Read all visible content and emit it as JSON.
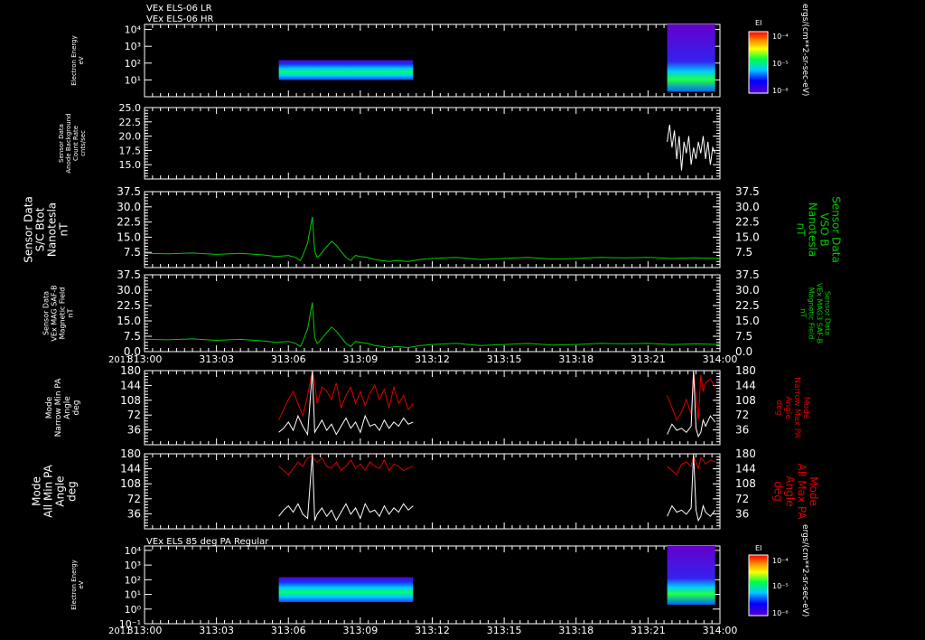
{
  "titles": {
    "top_line1": "VEx ELS-06 LR",
    "top_line2": "VEx ELS-06 HR",
    "bottom": "VEx ELS 85 deg PA Regular"
  },
  "colorbar": {
    "label": "EI",
    "ticks": [
      "10⁻⁴",
      "10⁻⁵",
      "10⁻⁶"
    ],
    "units": "ergs/(cm**2-sr-sec-eV)"
  },
  "time_axis": {
    "year": "2011",
    "ticks": [
      "313:00",
      "313:03",
      "313:06",
      "313:09",
      "313:12",
      "313:15",
      "313:18",
      "313:21",
      "314:00"
    ]
  },
  "colors": {
    "green": "#00cc00",
    "red": "#dd0000",
    "white": "#ffffff"
  },
  "chart_data": [
    {
      "type": "heatmap",
      "panel": "p1",
      "ylabel_lines": [
        "Electron Energy",
        "eV"
      ],
      "yticks": [
        "10⁴",
        "10³",
        "10²",
        "10¹"
      ],
      "ytick_values": [
        10000,
        1000,
        100,
        10
      ],
      "ylim": [
        1,
        20000
      ],
      "blocks": [
        {
          "x": [
            5.6,
            11.2
          ],
          "ylim": [
            10,
            150
          ]
        },
        {
          "x": [
            21.8,
            23.8
          ],
          "ylim": [
            2,
            20000
          ]
        }
      ]
    },
    {
      "type": "line",
      "panel": "p2",
      "ylabel_lines": [
        "Sensor Data",
        "Anode Background",
        "Count Rate",
        "cnts/sec"
      ],
      "yticks": [
        "25.0",
        "22.5",
        "20.0",
        "17.5",
        "15.0"
      ],
      "ytick_values": [
        25,
        22.5,
        20,
        17.5,
        15
      ],
      "ylim": [
        12.5,
        25
      ],
      "series": [
        {
          "color": "white",
          "x": [
            21.8,
            21.9,
            22.0,
            22.1,
            22.2,
            22.3,
            22.4,
            22.5,
            22.6,
            22.7,
            22.8,
            22.9,
            23.0,
            23.1,
            23.2,
            23.3,
            23.4,
            23.5,
            23.6,
            23.7,
            23.8
          ],
          "y": [
            19,
            22,
            18,
            21,
            16,
            20,
            14,
            19,
            17,
            20,
            15,
            18,
            16,
            19,
            17,
            20,
            16,
            19,
            15,
            18,
            17
          ]
        }
      ]
    },
    {
      "type": "line",
      "panel": "p3",
      "ylabel_lines": [
        "Sensor Data",
        "S/C Btot",
        "Nanotesla",
        "nT"
      ],
      "right_label_lines": [
        "Sensor Data",
        "VSO B",
        "Nanotesla",
        "nT"
      ],
      "yticks": [
        "37.5",
        "30.0",
        "22.5",
        "15.0",
        "7.5"
      ],
      "ytick_values": [
        37.5,
        30,
        22.5,
        15,
        7.5
      ],
      "ylim": [
        0,
        37.5
      ],
      "series": [
        {
          "color": "green",
          "x": [
            0,
            1,
            2,
            3,
            4,
            5,
            5.5,
            6,
            6.3,
            6.5,
            6.6,
            6.8,
            7.0,
            7.1,
            7.2,
            7.3,
            7.5,
            7.8,
            8.0,
            8.2,
            8.4,
            8.6,
            8.8,
            9.0,
            9.3,
            9.6,
            9.9,
            10.2,
            10.5,
            11.0,
            11.5,
            12,
            13,
            14,
            15,
            16,
            17,
            18,
            19,
            20,
            21,
            22,
            23,
            24
          ],
          "y": [
            7,
            6.8,
            7.2,
            6.5,
            7,
            6.2,
            5.5,
            6,
            5,
            3.5,
            6,
            12,
            25,
            8,
            5,
            6,
            9,
            13,
            11,
            8,
            5,
            3.5,
            6,
            5.5,
            5,
            4,
            3.5,
            3,
            3.5,
            3,
            4,
            4.5,
            5,
            4,
            4.5,
            5,
            4.2,
            4.5,
            5,
            4.8,
            5,
            4.5,
            4.8,
            4.5
          ]
        }
      ]
    },
    {
      "type": "line",
      "panel": "p4",
      "ylabel_lines": [
        "Sensor Data",
        "VEx MAG SAF-B",
        "Magnetic Field",
        "nT"
      ],
      "right_label_lines": [
        "Sensor Data",
        "VEx MAG3 SAF-B",
        "Magnetic Field",
        "nT"
      ],
      "yticks": [
        "37.5",
        "30.0",
        "22.5",
        "15.0",
        "7.5",
        "0.0"
      ],
      "ytick_values": [
        37.5,
        30,
        22.5,
        15,
        7.5,
        0
      ],
      "ylim": [
        0,
        37.5
      ],
      "series": [
        {
          "color": "green",
          "x": [
            0,
            1,
            2,
            3,
            4,
            5,
            5.5,
            6,
            6.3,
            6.5,
            6.6,
            6.8,
            7.0,
            7.1,
            7.2,
            7.3,
            7.5,
            7.8,
            8.0,
            8.2,
            8.4,
            8.6,
            8.8,
            9.0,
            9.3,
            9.6,
            9.9,
            10.2,
            10.5,
            11.0,
            11.5,
            12,
            13,
            14,
            15,
            16,
            17,
            18,
            19,
            20,
            21,
            22,
            23,
            24
          ],
          "y": [
            6,
            5.8,
            6.2,
            5.5,
            6,
            5.2,
            4.5,
            5,
            4,
            2.5,
            5,
            11,
            24,
            7,
            4,
            5,
            8,
            12,
            10,
            7,
            4,
            2.5,
            5,
            4.5,
            4,
            3,
            2.5,
            2,
            2.5,
            2,
            3,
            3.5,
            4,
            3,
            3.5,
            4,
            3.2,
            3.5,
            4,
            3.8,
            4,
            3.5,
            3.8,
            3.5
          ]
        }
      ]
    },
    {
      "type": "line",
      "panel": "p5",
      "ylabel_lines": [
        "Mode",
        "Narrow Min PA",
        "Angle",
        "deg"
      ],
      "right_label_lines": [
        "Mode",
        "Narrow Max PA",
        "Angle",
        "deg"
      ],
      "yticks": [
        "180",
        "144",
        "108",
        "72",
        "36"
      ],
      "ytick_values": [
        180,
        144,
        108,
        72,
        36
      ],
      "ylim": [
        0,
        180
      ],
      "series": [
        {
          "color": "red",
          "x": [
            5.6,
            5.8,
            6.0,
            6.2,
            6.4,
            6.6,
            6.8,
            7.0,
            7.1,
            7.2,
            7.4,
            7.6,
            7.8,
            8.0,
            8.2,
            8.4,
            8.6,
            8.8,
            9.0,
            9.2,
            9.4,
            9.6,
            9.8,
            10.0,
            10.2,
            10.4,
            10.6,
            10.8,
            11.0,
            11.2
          ],
          "y": [
            60,
            85,
            110,
            130,
            100,
            70,
            120,
            180,
            150,
            100,
            140,
            130,
            110,
            150,
            90,
            120,
            140,
            100,
            130,
            95,
            125,
            145,
            110,
            135,
            90,
            140,
            100,
            120,
            85,
            100
          ]
        },
        {
          "color": "white",
          "x": [
            5.6,
            5.8,
            6.0,
            6.2,
            6.4,
            6.6,
            6.8,
            7.0,
            7.1,
            7.2,
            7.4,
            7.6,
            7.8,
            8.0,
            8.2,
            8.4,
            8.6,
            8.8,
            9.0,
            9.2,
            9.4,
            9.6,
            9.8,
            10.0,
            10.2,
            10.4,
            10.6,
            10.8,
            11.0,
            11.2
          ],
          "y": [
            30,
            40,
            55,
            35,
            70,
            45,
            25,
            180,
            30,
            40,
            60,
            35,
            50,
            25,
            45,
            65,
            40,
            55,
            30,
            70,
            45,
            50,
            35,
            60,
            40,
            55,
            45,
            65,
            50,
            55
          ]
        },
        {
          "color": "red",
          "x": [
            21.8,
            22.0,
            22.2,
            22.4,
            22.6,
            22.8,
            22.9,
            23.0,
            23.1,
            23.2,
            23.3,
            23.4,
            23.6,
            23.8
          ],
          "y": [
            120,
            90,
            60,
            80,
            110,
            75,
            180,
            120,
            60,
            170,
            130,
            150,
            160,
            140
          ]
        },
        {
          "color": "white",
          "x": [
            21.8,
            22.0,
            22.2,
            22.4,
            22.6,
            22.8,
            22.9,
            23.0,
            23.1,
            23.2,
            23.3,
            23.4,
            23.6,
            23.8
          ],
          "y": [
            25,
            50,
            35,
            40,
            30,
            45,
            180,
            40,
            20,
            30,
            60,
            45,
            70,
            55
          ]
        }
      ]
    },
    {
      "type": "line",
      "panel": "p6",
      "ylabel_lines": [
        "Mode",
        "All Min PA",
        "Angle",
        "deg"
      ],
      "right_label_lines": [
        "Mode",
        "All Max PA",
        "Angle",
        "deg"
      ],
      "yticks": [
        "180",
        "144",
        "108",
        "72",
        "36"
      ],
      "ytick_values": [
        180,
        144,
        108,
        72,
        36
      ],
      "ylim": [
        0,
        180
      ],
      "series": [
        {
          "color": "red",
          "x": [
            5.6,
            5.8,
            6.0,
            6.2,
            6.4,
            6.6,
            6.8,
            7.0,
            7.1,
            7.2,
            7.4,
            7.6,
            7.8,
            8.0,
            8.2,
            8.4,
            8.6,
            8.8,
            9.0,
            9.2,
            9.4,
            9.6,
            9.8,
            10.0,
            10.2,
            10.4,
            10.6,
            10.8,
            11.0,
            11.2
          ],
          "y": [
            150,
            140,
            130,
            145,
            160,
            150,
            170,
            175,
            165,
            160,
            170,
            150,
            145,
            160,
            140,
            150,
            165,
            145,
            155,
            140,
            160,
            150,
            145,
            165,
            140,
            155,
            150,
            140,
            145,
            150
          ]
        },
        {
          "color": "white",
          "x": [
            5.6,
            5.8,
            6.0,
            6.2,
            6.4,
            6.6,
            6.8,
            7.0,
            7.1,
            7.2,
            7.4,
            7.6,
            7.8,
            8.0,
            8.2,
            8.4,
            8.6,
            8.8,
            9.0,
            9.2,
            9.4,
            9.6,
            9.8,
            10.0,
            10.2,
            10.4,
            10.6,
            10.8,
            11.0,
            11.2
          ],
          "y": [
            30,
            45,
            55,
            40,
            60,
            35,
            25,
            180,
            20,
            35,
            50,
            30,
            45,
            20,
            40,
            60,
            35,
            50,
            25,
            60,
            40,
            45,
            30,
            55,
            35,
            50,
            40,
            60,
            45,
            55
          ]
        },
        {
          "color": "red",
          "x": [
            21.8,
            22.0,
            22.2,
            22.4,
            22.6,
            22.8,
            22.9,
            23.0,
            23.1,
            23.2,
            23.3,
            23.4,
            23.6,
            23.8
          ],
          "y": [
            150,
            140,
            130,
            155,
            160,
            150,
            175,
            160,
            145,
            170,
            165,
            155,
            165,
            160
          ]
        },
        {
          "color": "white",
          "x": [
            21.8,
            22.0,
            22.2,
            22.4,
            22.6,
            22.8,
            22.9,
            23.0,
            23.1,
            23.2,
            23.3,
            23.4,
            23.6,
            23.8
          ],
          "y": [
            30,
            55,
            40,
            45,
            35,
            50,
            180,
            45,
            20,
            30,
            55,
            40,
            30,
            45
          ]
        }
      ]
    },
    {
      "type": "heatmap",
      "panel": "p7",
      "ylabel_lines": [
        "Electron Energy",
        "eV"
      ],
      "yticks": [
        "10⁴",
        "10³",
        "10²",
        "10¹",
        "10⁰",
        "10⁻¹"
      ],
      "ytick_values": [
        10000,
        1000,
        100,
        10,
        1,
        0.1
      ],
      "ylim": [
        0.1,
        20000
      ],
      "blocks": [
        {
          "x": [
            5.6,
            11.2
          ],
          "ylim": [
            3,
            150
          ]
        },
        {
          "x": [
            21.8,
            23.8
          ],
          "ylim": [
            2,
            20000
          ]
        }
      ]
    }
  ]
}
